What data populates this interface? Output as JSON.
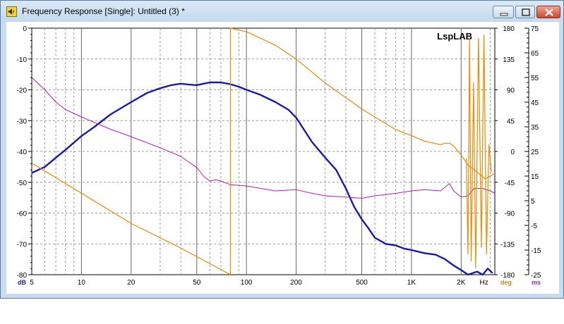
{
  "window": {
    "title": "Frequency Response [Single]: Untitled (3) *",
    "buttons": {
      "minimize": "minimize",
      "maximize": "maximize",
      "close": "close"
    }
  },
  "chart_data": {
    "type": "line",
    "watermark": "LspLAB",
    "x_axis": {
      "scale": "log",
      "range": [
        5,
        3200
      ],
      "tick_labels": [
        "5",
        "10",
        "20",
        "50",
        "100",
        "200",
        "500",
        "1K",
        "2K",
        "Hz"
      ],
      "tick_values": [
        5,
        10,
        20,
        50,
        100,
        200,
        500,
        1000,
        2000
      ]
    },
    "y_axes": [
      {
        "unit": "dB",
        "side": "left",
        "range": [
          -80,
          0
        ],
        "ticks": [
          0,
          -10,
          -20,
          -30,
          -40,
          -50,
          -60,
          -70,
          -80
        ],
        "color": "#1a1aa8"
      },
      {
        "unit": "deg",
        "side": "right",
        "range": [
          -180,
          180
        ],
        "ticks": [
          180,
          135,
          90,
          45,
          0,
          -45,
          -90,
          -135,
          -180
        ],
        "color": "#e88a00"
      },
      {
        "unit": "ms",
        "side": "right",
        "range": [
          -25,
          75
        ],
        "ticks": [
          75,
          65,
          55,
          45,
          35,
          25,
          15,
          5,
          -5,
          -15,
          -25
        ],
        "color": "#b020b0"
      }
    ],
    "grid": true,
    "series": [
      {
        "axis": "dB",
        "color": "#1a1aa8",
        "points": [
          [
            5,
            -47
          ],
          [
            6,
            -45
          ],
          [
            7,
            -42
          ],
          [
            8,
            -39.5
          ],
          [
            10,
            -35
          ],
          [
            12,
            -32
          ],
          [
            15,
            -28
          ],
          [
            20,
            -24
          ],
          [
            25,
            -21
          ],
          [
            30,
            -19.5
          ],
          [
            35,
            -18.5
          ],
          [
            40,
            -18
          ],
          [
            45,
            -18.3
          ],
          [
            50,
            -18.5
          ],
          [
            55,
            -18
          ],
          [
            60,
            -17.6
          ],
          [
            70,
            -17.6
          ],
          [
            80,
            -18.2
          ],
          [
            90,
            -19
          ],
          [
            100,
            -20
          ],
          [
            120,
            -21.5
          ],
          [
            150,
            -24
          ],
          [
            180,
            -26.5
          ],
          [
            200,
            -29
          ],
          [
            250,
            -37
          ],
          [
            300,
            -42
          ],
          [
            350,
            -46
          ],
          [
            400,
            -52
          ],
          [
            450,
            -58
          ],
          [
            500,
            -62
          ],
          [
            550,
            -65
          ],
          [
            600,
            -68
          ],
          [
            700,
            -70
          ],
          [
            800,
            -70.5
          ],
          [
            900,
            -71.5
          ],
          [
            1000,
            -72
          ],
          [
            1200,
            -73
          ],
          [
            1400,
            -73.5
          ],
          [
            1600,
            -75
          ],
          [
            1800,
            -77
          ],
          [
            2000,
            -78.5
          ],
          [
            2200,
            -80
          ],
          [
            2500,
            -79
          ],
          [
            2700,
            -80
          ],
          [
            2900,
            -78
          ],
          [
            3100,
            -79.5
          ]
        ]
      },
      {
        "axis": "ms",
        "color": "#b020b0",
        "points": [
          [
            5,
            55
          ],
          [
            6,
            50
          ],
          [
            7,
            45
          ],
          [
            8,
            42
          ],
          [
            10,
            39
          ],
          [
            15,
            34
          ],
          [
            20,
            31
          ],
          [
            30,
            26.5
          ],
          [
            40,
            23
          ],
          [
            50,
            18.5
          ],
          [
            55,
            15
          ],
          [
            60,
            13
          ],
          [
            65,
            13.5
          ],
          [
            70,
            13
          ],
          [
            80,
            11.5
          ],
          [
            100,
            11
          ],
          [
            150,
            9
          ],
          [
            200,
            9.5
          ],
          [
            250,
            8
          ],
          [
            300,
            7
          ],
          [
            400,
            6.5
          ],
          [
            500,
            6
          ],
          [
            600,
            7
          ],
          [
            800,
            8
          ],
          [
            1000,
            9
          ],
          [
            1200,
            9.5
          ],
          [
            1500,
            9
          ],
          [
            1700,
            12
          ],
          [
            1800,
            9
          ],
          [
            2000,
            6.5
          ],
          [
            2200,
            7
          ],
          [
            2400,
            10
          ],
          [
            2700,
            10
          ],
          [
            3000,
            9
          ],
          [
            3200,
            8
          ]
        ]
      },
      {
        "axis": "deg",
        "color": "#e88a00",
        "segments": [
          [
            [
              5,
              -17
            ],
            [
              10,
              -61
            ],
            [
              20,
              -105
            ],
            [
              40,
              -141
            ],
            [
              80,
              -180
            ]
          ],
          [
            [
              80,
              -180
            ],
            [
              80,
              180
            ]
          ],
          [
            [
              80,
              180
            ],
            [
              100,
              175
            ],
            [
              150,
              155
            ],
            [
              200,
              135
            ],
            [
              300,
              100
            ],
            [
              500,
              62
            ],
            [
              800,
              32
            ],
            [
              1000,
              23
            ],
            [
              1200,
              15
            ],
            [
              1500,
              10
            ],
            [
              1600,
              12
            ],
            [
              1700,
              12
            ],
            [
              1800,
              8
            ],
            [
              2000,
              -5
            ],
            [
              2200,
              -20
            ],
            [
              2500,
              -30
            ],
            [
              2800,
              -40
            ],
            [
              3200,
              -32
            ]
          ],
          [
            [
              2150,
              -10
            ],
            [
              2200,
              -150
            ],
            [
              2250,
              165
            ],
            [
              2300,
              -160
            ],
            [
              2380,
              100
            ],
            [
              2450,
              -170
            ],
            [
              2550,
              165
            ],
            [
              2650,
              -140
            ],
            [
              2750,
              170
            ],
            [
              2850,
              -150
            ],
            [
              2950,
              10
            ],
            [
              3050,
              -30
            ]
          ]
        ]
      }
    ]
  }
}
